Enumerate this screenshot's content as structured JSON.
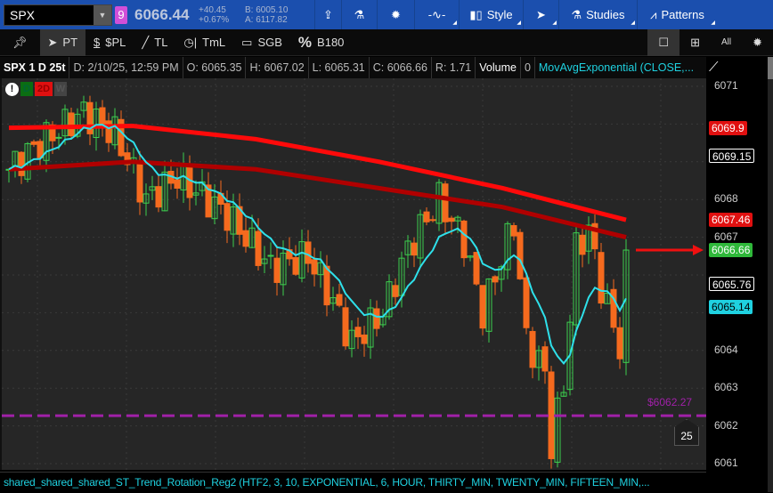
{
  "header": {
    "symbol": "SPX",
    "dropdown_icon": "chevron-down-icon",
    "link_group": "9",
    "last": "6066.44",
    "change": "+40.45",
    "change_pct": "+0.67%",
    "bid": "B: 6005.10",
    "ask": "A: 6117.82",
    "buttons": [
      {
        "icon": "share-icon",
        "label": ""
      },
      {
        "icon": "flask-icon",
        "label": ""
      },
      {
        "icon": "gear-icon",
        "label": ""
      },
      {
        "icon": "heartbeat-icon",
        "label": ""
      },
      {
        "icon": "candles-icon",
        "label": "Style"
      },
      {
        "icon": "cursor-icon",
        "label": ""
      },
      {
        "icon": "flask-icon",
        "label": "Studies"
      },
      {
        "icon": "patterns-icon",
        "label": "Patterns"
      }
    ]
  },
  "drawing_tools": [
    {
      "icon": "pin-icon",
      "label": ""
    },
    {
      "icon": "cursor-icon",
      "label": "PT"
    },
    {
      "icon": "dollar-icon",
      "label": "$PL"
    },
    {
      "icon": "line-icon",
      "label": "TL"
    },
    {
      "icon": "clock-icon",
      "label": "TmL"
    },
    {
      "icon": "rect-icon",
      "label": "SGB"
    },
    {
      "icon": "percent-icon",
      "label": "B180"
    }
  ],
  "layout_tools": {
    "all": "All"
  },
  "info": {
    "title": "SPX 1 D 25t",
    "date": "D: 2/10/25, 12:59 PM",
    "open": "O: 6065.35",
    "high": "H: 6067.02",
    "low": "L: 6065.31",
    "close": "C: 6066.66",
    "range": "R: 1.71",
    "volume_label": "Volume",
    "volume": "0",
    "study": "MovAvgExponential (CLOSE,..."
  },
  "badges": {
    "alert": "!",
    "d": "D",
    "d2": "2D",
    "w": "W"
  },
  "axis": {
    "ticks": [
      "6071",
      "6068",
      "6067",
      "6064",
      "6063",
      "6062",
      "6061"
    ],
    "tick_values": [
      6071,
      6068,
      6067,
      6064,
      6063,
      6062,
      6061
    ],
    "markers": [
      {
        "text": "6069.9",
        "value": 6069.9,
        "bg": "#e01010",
        "fg": "#fff"
      },
      {
        "text": "6069.15",
        "value": 6069.15,
        "bg": "#000",
        "fg": "#fff",
        "border": "#fff"
      },
      {
        "text": "6067.46",
        "value": 6067.46,
        "bg": "#e01010",
        "fg": "#fff"
      },
      {
        "text": "6066.66",
        "value": 6066.66,
        "bg": "#2fb83a",
        "fg": "#fff"
      },
      {
        "text": "6065.76",
        "value": 6065.76,
        "bg": "#000",
        "fg": "#fff",
        "border": "#fff"
      },
      {
        "text": "6065.14",
        "value": 6065.14,
        "bg": "#1fd1e0",
        "fg": "#000"
      }
    ]
  },
  "price_level": {
    "text": "$6062.27",
    "value": 6062.27,
    "color": "#a020a8"
  },
  "tick_count": "25",
  "bottom_study": "shared_shared_shared_ST_Trend_Rotation_Reg2 (HTF2, 3, 10, EXPONENTIAL, 6, HOUR, THIRTY_MIN, TWENTY_MIN, FIFTEEN_MIN,...",
  "chart_data": {
    "type": "candlestick",
    "ylim": [
      6060.9,
      6071.2
    ],
    "bars": 100,
    "close_path": [
      [
        0,
        6068.8
      ],
      [
        5,
        6069.5
      ],
      [
        12,
        6070.3
      ],
      [
        17,
        6069.75
      ],
      [
        22,
        6068
      ],
      [
        27,
        6068.6
      ],
      [
        35,
        6067.6
      ],
      [
        42,
        6066.2
      ],
      [
        48,
        6066.5
      ],
      [
        52,
        6065.3
      ],
      [
        55,
        6064.2
      ],
      [
        60,
        6065
      ],
      [
        64,
        6066.7
      ],
      [
        69,
        6068
      ],
      [
        73,
        6066.9
      ],
      [
        76,
        6065
      ],
      [
        81,
        6067.4
      ],
      [
        83,
        6064.3
      ],
      [
        86,
        6063.4
      ],
      [
        87,
        6061.5
      ],
      [
        89,
        6063.1
      ],
      [
        91,
        6066.7
      ],
      [
        93,
        6067.2
      ],
      [
        95,
        6065.7
      ],
      [
        98,
        6064.1
      ],
      [
        99,
        6066.66
      ]
    ],
    "ema_period": 9,
    "ma_fast": [
      [
        0,
        6069.9
      ],
      [
        20,
        6069.95
      ],
      [
        40,
        6069.6
      ],
      [
        60,
        6069.0
      ],
      [
        80,
        6068.3
      ],
      [
        100,
        6067.46
      ]
    ],
    "ma_slow": [
      [
        0,
        6068.8
      ],
      [
        20,
        6069.0
      ],
      [
        40,
        6068.8
      ],
      [
        60,
        6068.3
      ],
      [
        80,
        6067.8
      ],
      [
        100,
        6067.0
      ]
    ],
    "colors": {
      "up": "#3ccf4e",
      "down": "#f56a1e",
      "ema": "#2ee0ea",
      "ma_fast": "#ff0a0a",
      "ma_slow": "#b00000"
    }
  }
}
